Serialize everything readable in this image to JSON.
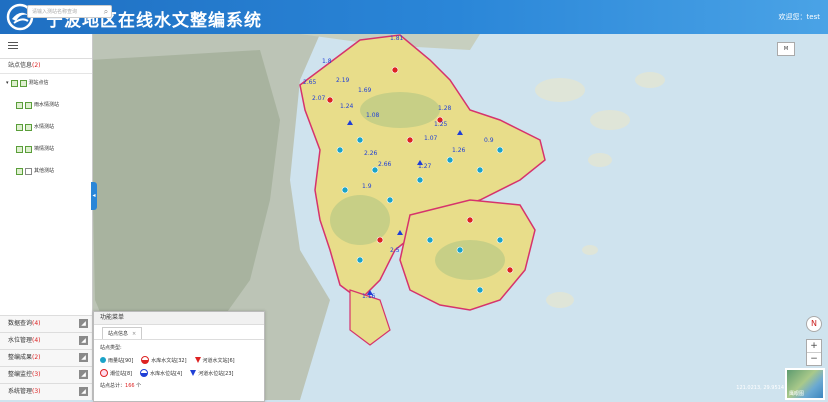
{
  "header": {
    "title": "宁波地区在线水文整编系统",
    "welcome": "欢迎您：test"
  },
  "sidebar": {
    "search_placeholder": "请输入测站名称查询",
    "section_title": "站点信息",
    "section_count": "(2)",
    "tree": {
      "root": "测站点信",
      "children": [
        "雨水情测站",
        "水情测站",
        "墒情测站",
        "其他测站"
      ]
    },
    "bottom_items": [
      {
        "label": "数据查询",
        "count": "(4)"
      },
      {
        "label": "水位管理",
        "count": "(4)"
      },
      {
        "label": "整编成果",
        "count": "(2)"
      },
      {
        "label": "整编监控",
        "count": "(3)"
      },
      {
        "label": "系统管理",
        "count": "(3)"
      }
    ]
  },
  "legend": {
    "header": "功能菜单",
    "tab": "站点信息",
    "tab_close": "×",
    "subtitle": "站点类型:",
    "row1": [
      {
        "label": "雨量站[90]",
        "symbol": "circle-blue"
      },
      {
        "label": "水库水文站[32]",
        "symbol": "circle-red"
      },
      {
        "label": "河道水文站[6]",
        "symbol": "triangle-red"
      }
    ],
    "row2": [
      {
        "label": "潮位站[8]",
        "symbol": "circle-red-slash"
      },
      {
        "label": "水库水位站[4]",
        "symbol": "circle-blue-half"
      },
      {
        "label": "河道水位站[23]",
        "symbol": "triangle-blue"
      }
    ],
    "total_label": "站点总计：",
    "total_value": "166",
    "total_unit": "个"
  },
  "map": {
    "scale_label": "M",
    "coords": "121.0213, 29.9514",
    "overview_label": "鹰眼图",
    "compass": "N",
    "labels": [
      "1.81",
      "1.8",
      "2.65",
      "2.19",
      "2.07",
      "1.69",
      "1.24",
      "1.08",
      "1.28",
      "1.25",
      "1.07",
      "0.9",
      "1.26",
      "2.26",
      "1.27",
      "2.66",
      "1.9",
      "2.5",
      "1.16"
    ]
  },
  "colors": {
    "header": "#2a86d8",
    "region": "#e8dd8a",
    "boundary": "#d6336c",
    "station_blue": "#1aa3c8",
    "station_red": "#d22"
  }
}
